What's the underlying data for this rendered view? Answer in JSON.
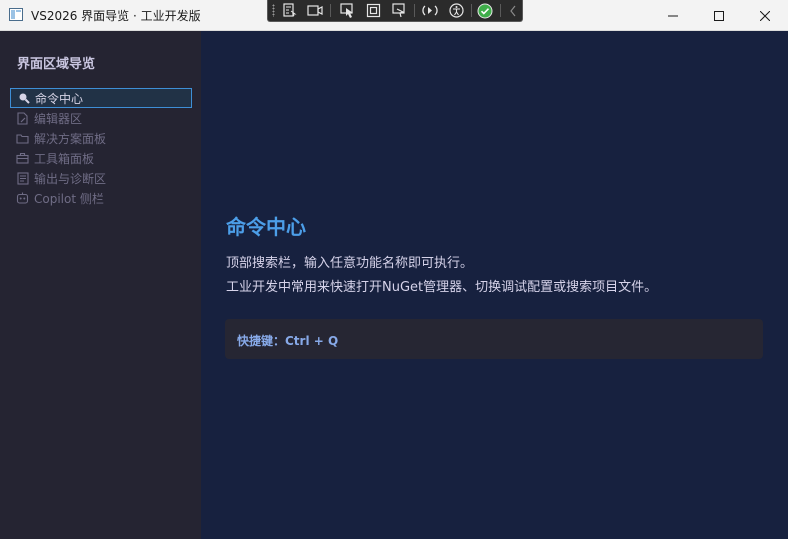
{
  "window": {
    "title": "VS2026 界面导览 · 工业开发版"
  },
  "debug_toolbar": {
    "icons": [
      "live-visual-tree-icon",
      "record-icon",
      "select-element-icon",
      "display-layout-adorners-icon",
      "track-focused-element-icon",
      "hot-reload-icon",
      "accessibility-icon",
      "binding-check-icon",
      "collapse-chevron-icon"
    ]
  },
  "sidebar": {
    "title": "界面区域导览",
    "items": [
      {
        "label": "命令中心",
        "icon": "search-icon",
        "active": true
      },
      {
        "label": "编辑器区",
        "icon": "document-edit-icon",
        "active": false
      },
      {
        "label": "解决方案面板",
        "icon": "folder-icon",
        "active": false
      },
      {
        "label": "工具箱面板",
        "icon": "toolbox-icon",
        "active": false
      },
      {
        "label": "输出与诊断区",
        "icon": "output-icon",
        "active": false
      },
      {
        "label": "Copilot 侧栏",
        "icon": "copilot-icon",
        "active": false
      }
    ]
  },
  "main": {
    "title": "命令中心",
    "description_line1": "顶部搜索栏，输入任意功能名称即可执行。",
    "description_line2": "工业开发中常用来快速打开NuGet管理器、切换调试配置或搜索项目文件。",
    "shortcut": "快捷键：Ctrl + Q"
  },
  "colors": {
    "sidebar_bg": "#252432",
    "main_bg": "#17213f",
    "accent": "#4c9ee8",
    "active_border": "#3e8fd6",
    "shortcut_text": "#87a9e8"
  }
}
